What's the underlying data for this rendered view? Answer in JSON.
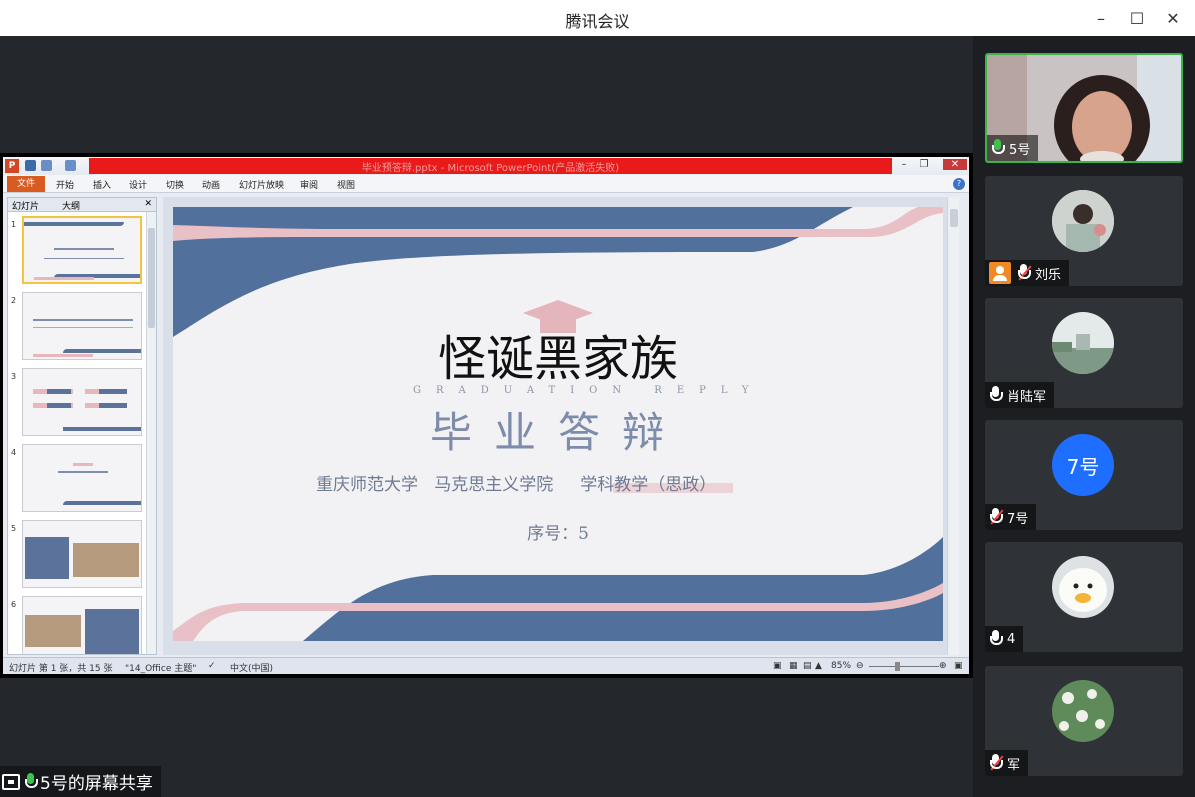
{
  "window": {
    "title": "腾讯会议"
  },
  "share": {
    "label": "5号的屏幕共享"
  },
  "ppt": {
    "doc_title": "毕业预答辩.pptx - Microsoft PowerPoint(产品激活失败)",
    "ribbon_tabs": [
      "文件",
      "开始",
      "插入",
      "设计",
      "切换",
      "动画",
      "幻灯片放映",
      "审阅",
      "视图"
    ],
    "panel_tabs": [
      "幻灯片",
      "大纲"
    ],
    "thumb_numbers": [
      "1",
      "2",
      "3",
      "4",
      "5",
      "6"
    ],
    "slide": {
      "title": "怪诞黑家族",
      "english": "GRADUATION REPLY",
      "subtitle": "毕业答辩",
      "school": "重庆师范大学   马克思主义学院     学科教学（思政）",
      "number": "序号：5"
    },
    "status": {
      "slide_info": "幻灯片 第 1 张，共 15 张",
      "theme": "\"14_Office 主题\"",
      "language": "中文(中国)",
      "zoom": "85%"
    }
  },
  "participants": [
    {
      "name": "5号",
      "mic": "on",
      "active": true,
      "host": false
    },
    {
      "name": "刘乐",
      "mic": "muted",
      "active": false,
      "host": true
    },
    {
      "name": "肖陆军",
      "mic": "open",
      "active": false,
      "host": false
    },
    {
      "name": "7号",
      "mic": "muted",
      "active": false,
      "host": false,
      "avatar_text": "7号"
    },
    {
      "name": "4",
      "mic": "open",
      "active": false,
      "host": false
    },
    {
      "name": "军",
      "mic": "muted",
      "active": false,
      "host": false
    }
  ],
  "colors": {
    "accent_green": "#39b54a",
    "slide_blue": "#52709c",
    "slide_pink": "#e9c0c5",
    "avatar_blue": "#1e6fff"
  }
}
